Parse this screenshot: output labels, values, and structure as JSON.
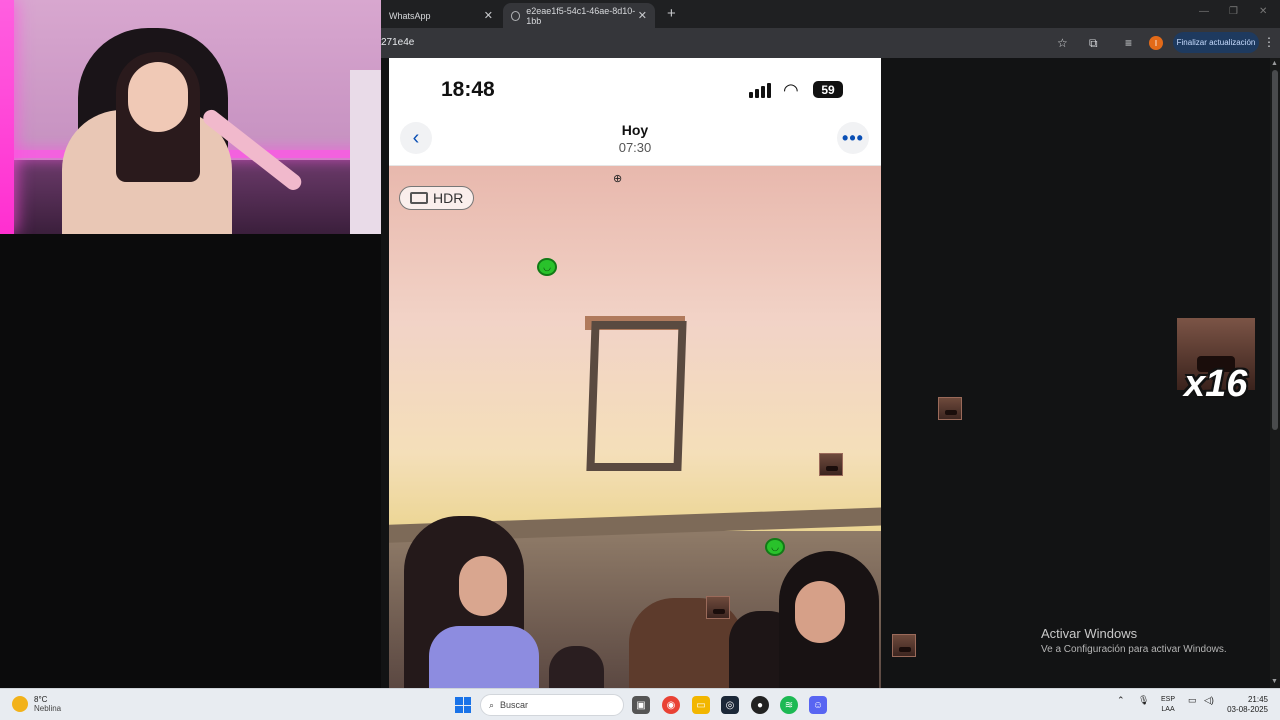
{
  "browser": {
    "tabs": [
      {
        "label": "WhatsApp",
        "active": false
      },
      {
        "label": "e2eae1f5-54c1-46ae-8d10-1bb",
        "active": true
      }
    ],
    "new_tab_label": "+",
    "url": "271e4e",
    "update_button": "Finalizar actualización",
    "profile_initial": "I"
  },
  "phone": {
    "status_time": "18:48",
    "battery": "59",
    "nav_title": "Hoy",
    "nav_subtitle": "07:30",
    "hdr_badge": "HDR"
  },
  "overlay": {
    "multiplier": "x16"
  },
  "watermark": {
    "title": "Activar Windows",
    "subtitle": "Ve a Configuración para activar Windows."
  },
  "taskbar": {
    "weather_temp": "8°C",
    "weather_desc": "Neblina",
    "search_placeholder": "Buscar",
    "lang_top": "ESP",
    "lang_bottom": "LAA",
    "time": "21:45",
    "date": "03-08-2025"
  },
  "colors": {
    "accent": "#1a73e8",
    "update_button_bg": "#1e3a5f",
    "phone_link_blue": "#0a4fb5"
  }
}
